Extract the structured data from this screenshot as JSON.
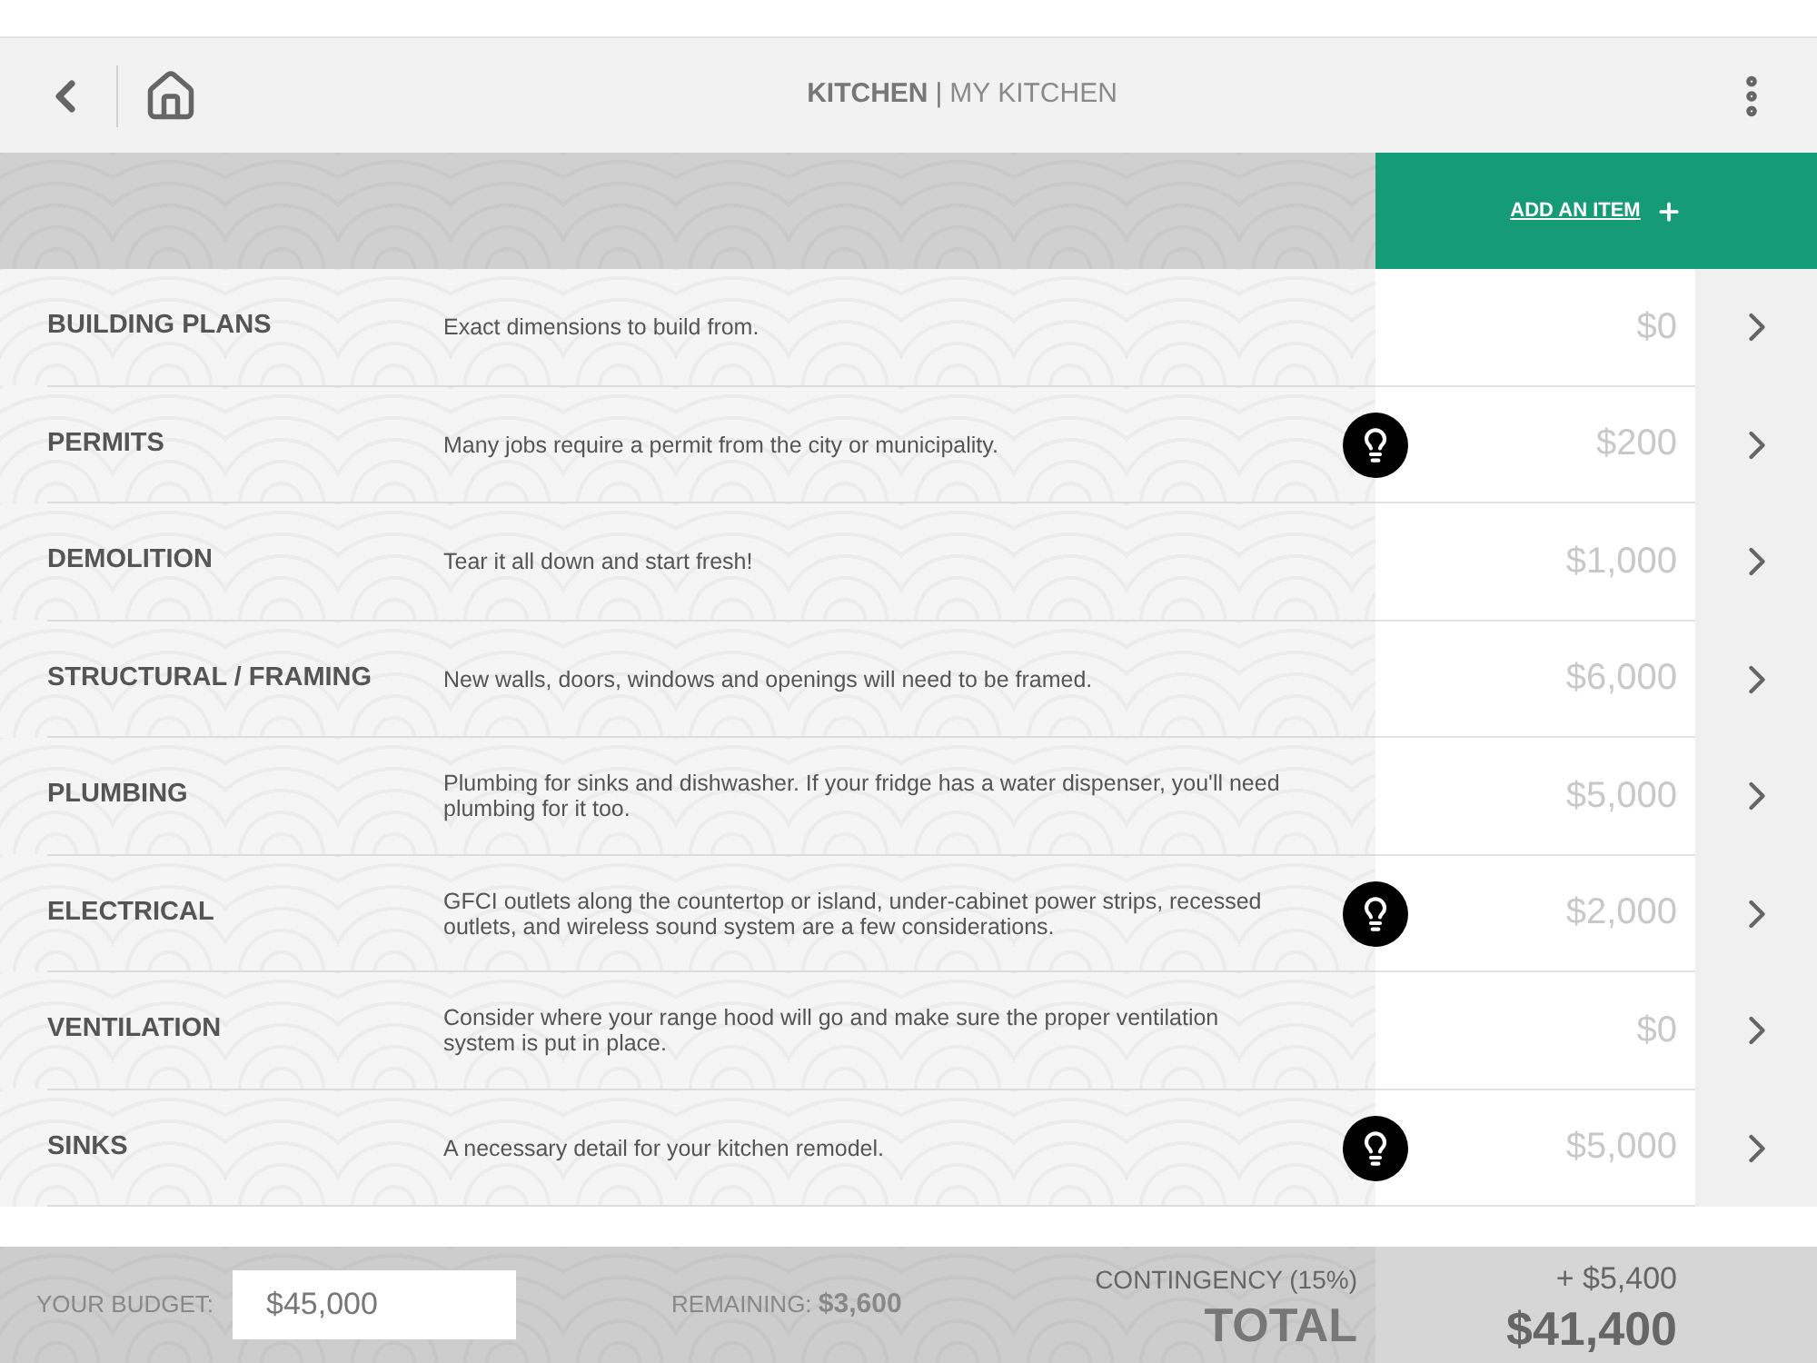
{
  "header": {
    "title": "KITCHEN",
    "separator": "|",
    "subtitle": "MY KITCHEN"
  },
  "add_item": {
    "label": "ADD AN ITEM"
  },
  "items": [
    {
      "name": "BUILDING PLANS",
      "description": "Exact dimensions to build from.",
      "tip": false,
      "amount": "$0"
    },
    {
      "name": "PERMITS",
      "description": "Many jobs require a permit from the city or municipality.",
      "tip": true,
      "amount": "$200"
    },
    {
      "name": "DEMOLITION",
      "description": "Tear it all down and start fresh!",
      "tip": false,
      "amount": "$1,000"
    },
    {
      "name": "STRUCTURAL / FRAMING",
      "description": "New walls, doors, windows and openings will need to be framed.",
      "tip": false,
      "amount": "$6,000"
    },
    {
      "name": "PLUMBING",
      "description": "Plumbing for sinks and dishwasher. If your fridge has a water dispenser, you'll need plumbing for it too.",
      "tip": false,
      "amount": "$5,000"
    },
    {
      "name": "ELECTRICAL",
      "description": "GFCI outlets along the countertop or island, under-cabinet power strips, recessed outlets, and wireless sound system are a few considerations.",
      "tip": true,
      "amount": "$2,000"
    },
    {
      "name": "VENTILATION",
      "description": "Consider where your range hood will go and make sure the proper ventilation system is put in place.",
      "tip": false,
      "amount": "$0"
    },
    {
      "name": "SINKS",
      "description": "A necessary detail for your kitchen remodel.",
      "tip": true,
      "amount": "$5,000"
    }
  ],
  "footer": {
    "budget_label": "YOUR BUDGET:",
    "budget_value": "$45,000",
    "remaining": "REMAINING: **$3,600**",
    "contingency_label": "CONTINGENCY (15%)",
    "contingency_value": "+ $5,400",
    "total_label": "TOTAL",
    "total_value": "$41,400"
  }
}
